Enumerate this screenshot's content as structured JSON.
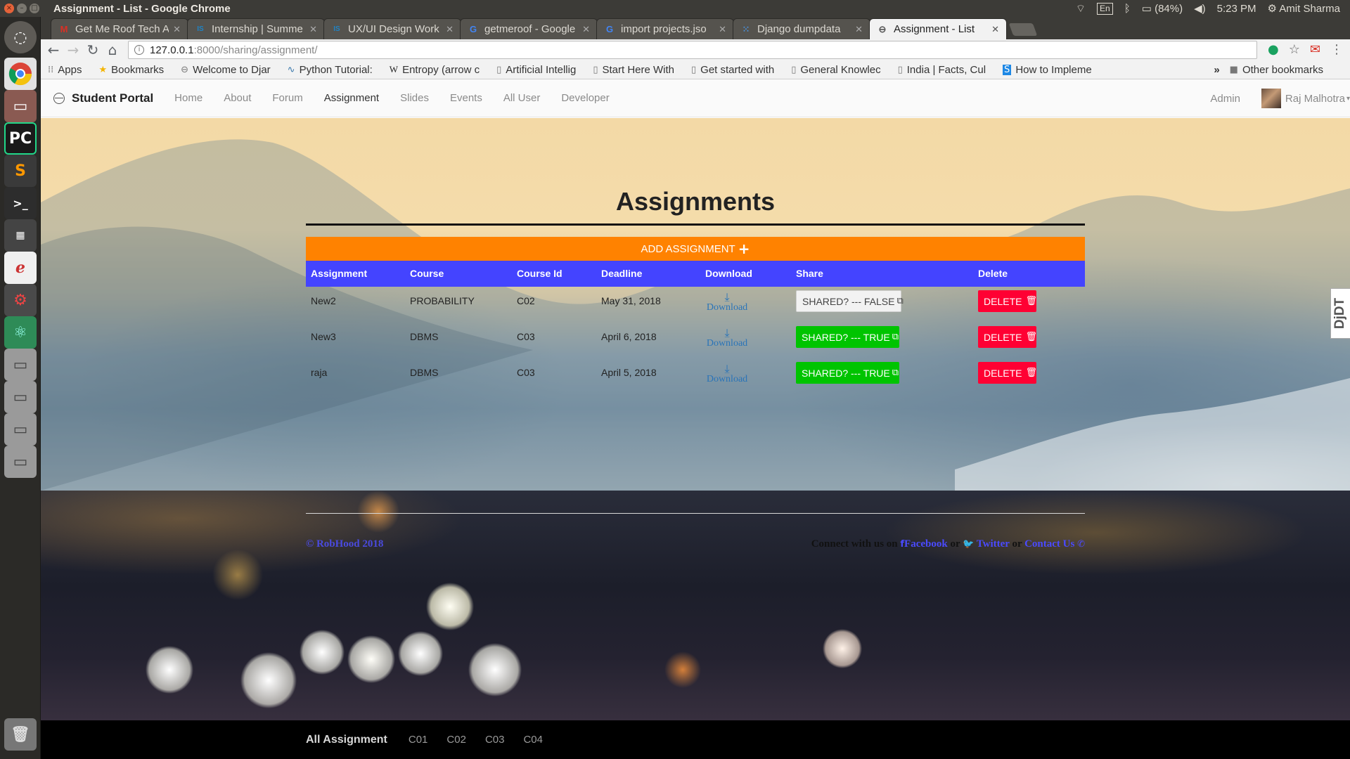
{
  "os": {
    "window_title": "Assignment - List - Google Chrome",
    "keyboard": "En",
    "battery": "(84%)",
    "clock": "5:23 PM",
    "user": "Amit Sharma"
  },
  "tabs": [
    {
      "title": "Get Me Roof Tech A",
      "icon": "gmail-icon",
      "icon_glyph": "M",
      "icon_color": "#d93025"
    },
    {
      "title": "Internship | Summe",
      "icon": "internshala-icon",
      "icon_glyph": "IS",
      "icon_color": "#1f84c5"
    },
    {
      "title": "UX/UI Design Work",
      "icon": "internshala-icon",
      "icon_glyph": "IS",
      "icon_color": "#1f84c5"
    },
    {
      "title": "getmeroof - Google",
      "icon": "google-icon",
      "icon_glyph": "G",
      "icon_color": "#4285f4"
    },
    {
      "title": "import projects.jso",
      "icon": "google-icon",
      "icon_glyph": "G",
      "icon_color": "#4285f4"
    },
    {
      "title": "Django dumpdata",
      "icon": "grid-icon",
      "icon_glyph": "⁙",
      "icon_color": "#4a90d9"
    },
    {
      "title": "Assignment - List",
      "icon": "globe-icon",
      "icon_glyph": "⊖",
      "icon_color": "#555555",
      "active": true
    }
  ],
  "address_bar": {
    "host": "127.0.0.1",
    "path": ":8000/sharing/assignment/"
  },
  "bookmarks": {
    "items": [
      {
        "label": "Apps",
        "icon": "apps-grid-icon"
      },
      {
        "label": "Bookmarks",
        "icon": "star-icon"
      },
      {
        "label": "Welcome to Djar",
        "icon": "globe-icon"
      },
      {
        "label": "Python Tutorial:",
        "icon": "python-icon"
      },
      {
        "label": "Entropy (arrow c",
        "icon": "wikipedia-icon"
      },
      {
        "label": "Artificial Intellig",
        "icon": "page-icon"
      },
      {
        "label": "Start Here With",
        "icon": "page-icon"
      },
      {
        "label": "Get started with",
        "icon": "page-icon"
      },
      {
        "label": "General Knowlec",
        "icon": "page-icon"
      },
      {
        "label": "India | Facts, Cul",
        "icon": "page-icon"
      },
      {
        "label": "How to Impleme",
        "icon": "s-icon"
      }
    ],
    "overflow": "»",
    "other": "Other bookmarks"
  },
  "navbar": {
    "brand": "Student Portal",
    "links": [
      "Home",
      "About",
      "Forum",
      "Assignment",
      "Slides",
      "Events",
      "All User",
      "Developer"
    ],
    "active": "Assignment",
    "admin": "Admin",
    "user": "Raj Malhotra"
  },
  "page": {
    "title": "Assignments",
    "add_button": "ADD ASSIGNMENT",
    "columns": [
      "Assignment",
      "Course",
      "Course Id",
      "Deadline",
      "Download",
      "Share",
      "Delete"
    ],
    "rows": [
      {
        "assignment": "New2",
        "course": "PROBABILITY",
        "course_id": "C02",
        "deadline": "May 31, 2018",
        "download": "Download",
        "share": "SHARED? --- FALSE",
        "shared": false,
        "delete": "DELETE"
      },
      {
        "assignment": "New3",
        "course": "DBMS",
        "course_id": "C03",
        "deadline": "April 6, 2018",
        "download": "Download",
        "share": "SHARED? --- TRUE",
        "shared": true,
        "delete": "DELETE"
      },
      {
        "assignment": "raja",
        "course": "DBMS",
        "course_id": "C03",
        "deadline": "April 5, 2018",
        "download": "Download",
        "share": "SHARED? --- TRUE",
        "shared": true,
        "delete": "DELETE"
      }
    ]
  },
  "footer": {
    "copyright": "© RobHood 2018",
    "connect_prefix": "Connect with us on",
    "facebook": "Facebook",
    "or1": "or",
    "twitter": "Twitter",
    "or2": "or",
    "contact": "Contact Us"
  },
  "bottom_nav": {
    "brand": "All Assignment",
    "links": [
      "C01",
      "C02",
      "C03",
      "C04"
    ]
  },
  "ddt_toolbar": "DjDT",
  "colors": {
    "add_button": "#ff8200",
    "table_header": "#4444ff",
    "shared_true": "#00c400",
    "delete": "#ff0033",
    "link": "#4a4aff"
  }
}
